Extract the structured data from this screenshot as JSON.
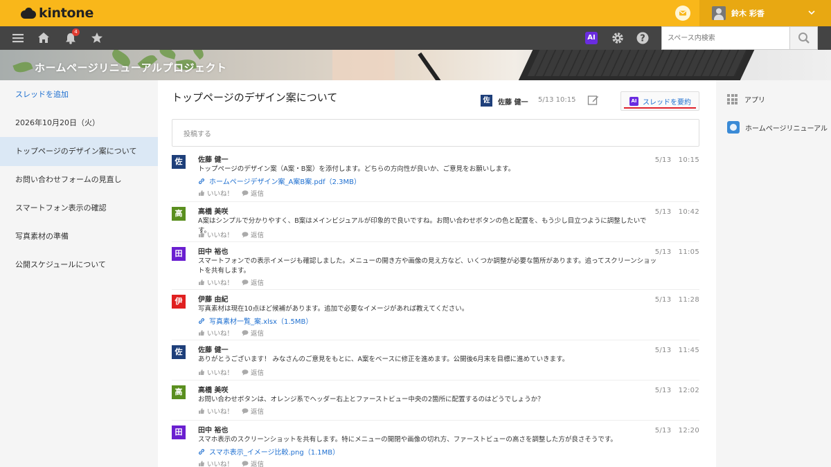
{
  "header": {
    "logo_text": "kintone",
    "user_name": "鈴木 彩香"
  },
  "toolbar": {
    "notification_count": "4",
    "ai_label": "AI",
    "search_placeholder": "スペース内検索"
  },
  "space": {
    "title": "ホームページリニューアルプロジェクト"
  },
  "sidebar": {
    "add_thread": "スレッドを追加",
    "items": [
      {
        "label": "2026年10月20日（火）"
      },
      {
        "label": "トップページのデザイン案について"
      },
      {
        "label": "お問い合わせフォームの見直し"
      },
      {
        "label": "スマートフォン表示の確認"
      },
      {
        "label": "写真素材の準備"
      },
      {
        "label": "公開スケジュールについて"
      }
    ]
  },
  "thread": {
    "title": "トップページのデザイン案について",
    "author_initial": "佐",
    "author": "佐藤 健一",
    "time": "5/13 10:15",
    "summarize_ai": "AI",
    "summarize_label": "スレッドを要約",
    "post_placeholder": "投稿する"
  },
  "comments": [
    {
      "initial": "佐",
      "name": "佐藤 健一",
      "time": "5/13　10:15",
      "color": "#1e3f7a",
      "text": "トップページのデザイン案（A案・B案）を添付します。どちらの方向性が良いか、ご意見をお願いします。",
      "attachment": "ホームページデザイン案_A案B案.pdf（2.3MB）",
      "like": "いいね！",
      "reply": "返信"
    },
    {
      "initial": "高",
      "name": "高橋 美咲",
      "time": "5/13　10:42",
      "color": "#5a8f1f",
      "text": "A案はシンプルで分かりやすく、B案はメインビジュアルが印象的で良いですね。お問い合わせボタンの色と配置を、もう少し目立つように調整したいです。",
      "like": "いいね！",
      "reply": "返信"
    },
    {
      "initial": "田",
      "name": "田中 裕也",
      "time": "5/13　11:05",
      "color": "#6a1fd0",
      "text": "スマートフォンでの表示イメージも確認しました。メニューの開き方や画像の見え方など、いくつか調整が必要な箇所があります。追ってスクリーンショットを共有します。",
      "like": "いいね！",
      "reply": "返信"
    },
    {
      "initial": "伊",
      "name": "伊藤 由紀",
      "time": "5/13　11:28",
      "color": "#e02020",
      "text": "写真素材は現在10点ほど候補があります。追加で必要なイメージがあれば教えてください。",
      "attachment": "写真素材一覧_案.xlsx（1.5MB）",
      "like": "いいね！",
      "reply": "返信"
    },
    {
      "initial": "佐",
      "name": "佐藤 健一",
      "time": "5/13　11:45",
      "color": "#1e3f7a",
      "text": "ありがとうございます！ みなさんのご意見をもとに、A案をベースに修正を進めます。公開後6月末を目標に進めていきます。",
      "like": "いいね！",
      "reply": "返信"
    },
    {
      "initial": "高",
      "name": "高橋 美咲",
      "time": "5/13　12:02",
      "color": "#5a8f1f",
      "text": "お問い合わせボタンは、オレンジ系でヘッダー右上とファーストビュー中央の2箇所に配置するのはどうでしょうか？",
      "like": "いいね！",
      "reply": "返信"
    },
    {
      "initial": "田",
      "name": "田中 裕也",
      "time": "5/13　12:20",
      "color": "#6a1fd0",
      "text": "スマホ表示のスクリーンショットを共有します。特にメニューの開閉や画像の切れ方、ファーストビューの高さを調整した方が良さそうです。",
      "attachment": "スマホ表示_イメージ比較.png（1.1MB）",
      "like": "いいね！",
      "reply": "返信"
    }
  ],
  "rightbar": {
    "apps_label": "アプリ",
    "app_name": "ホームページリニューアル"
  },
  "colors": {
    "brand_yellow": "#f9b71a",
    "toolbar_dark": "#444444",
    "ai_purple": "#6a2ce0",
    "link_blue": "#1e6fd0",
    "highlight_red": "#e0202a"
  }
}
